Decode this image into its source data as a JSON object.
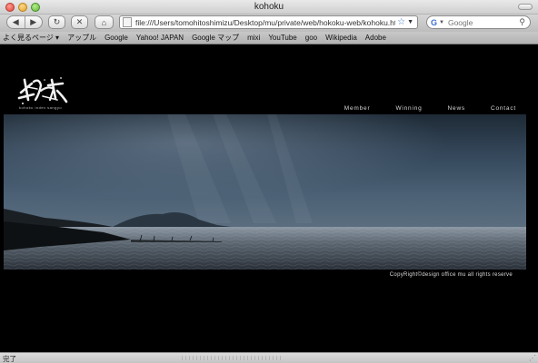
{
  "window": {
    "title": "kohoku"
  },
  "toolbar": {
    "back_icon": "◀",
    "forward_icon": "▶",
    "reload_icon": "↻",
    "stop_icon": "✕",
    "home_icon": "⌂",
    "url": "file:///Users/tomohitoshimizu/Desktop/mu/private/web/hokoku-web/kohoku.html",
    "search_placeholder": "Google",
    "search_engine_letter": "G"
  },
  "bookmarks": [
    "よく見るページ ▾",
    "アップル",
    "Google",
    "Yahoo! JAPAN",
    "Google マップ",
    "mixi",
    "YouTube",
    "goo",
    "Wikipedia",
    "Adobe"
  ],
  "site": {
    "logo_subtitle": "kohoku index sangyo",
    "nav": [
      "Member",
      "Winning",
      "News",
      "Contact"
    ],
    "copyright": "CopyRight©design office mu all rights reserve"
  },
  "status": {
    "text": "完了"
  }
}
